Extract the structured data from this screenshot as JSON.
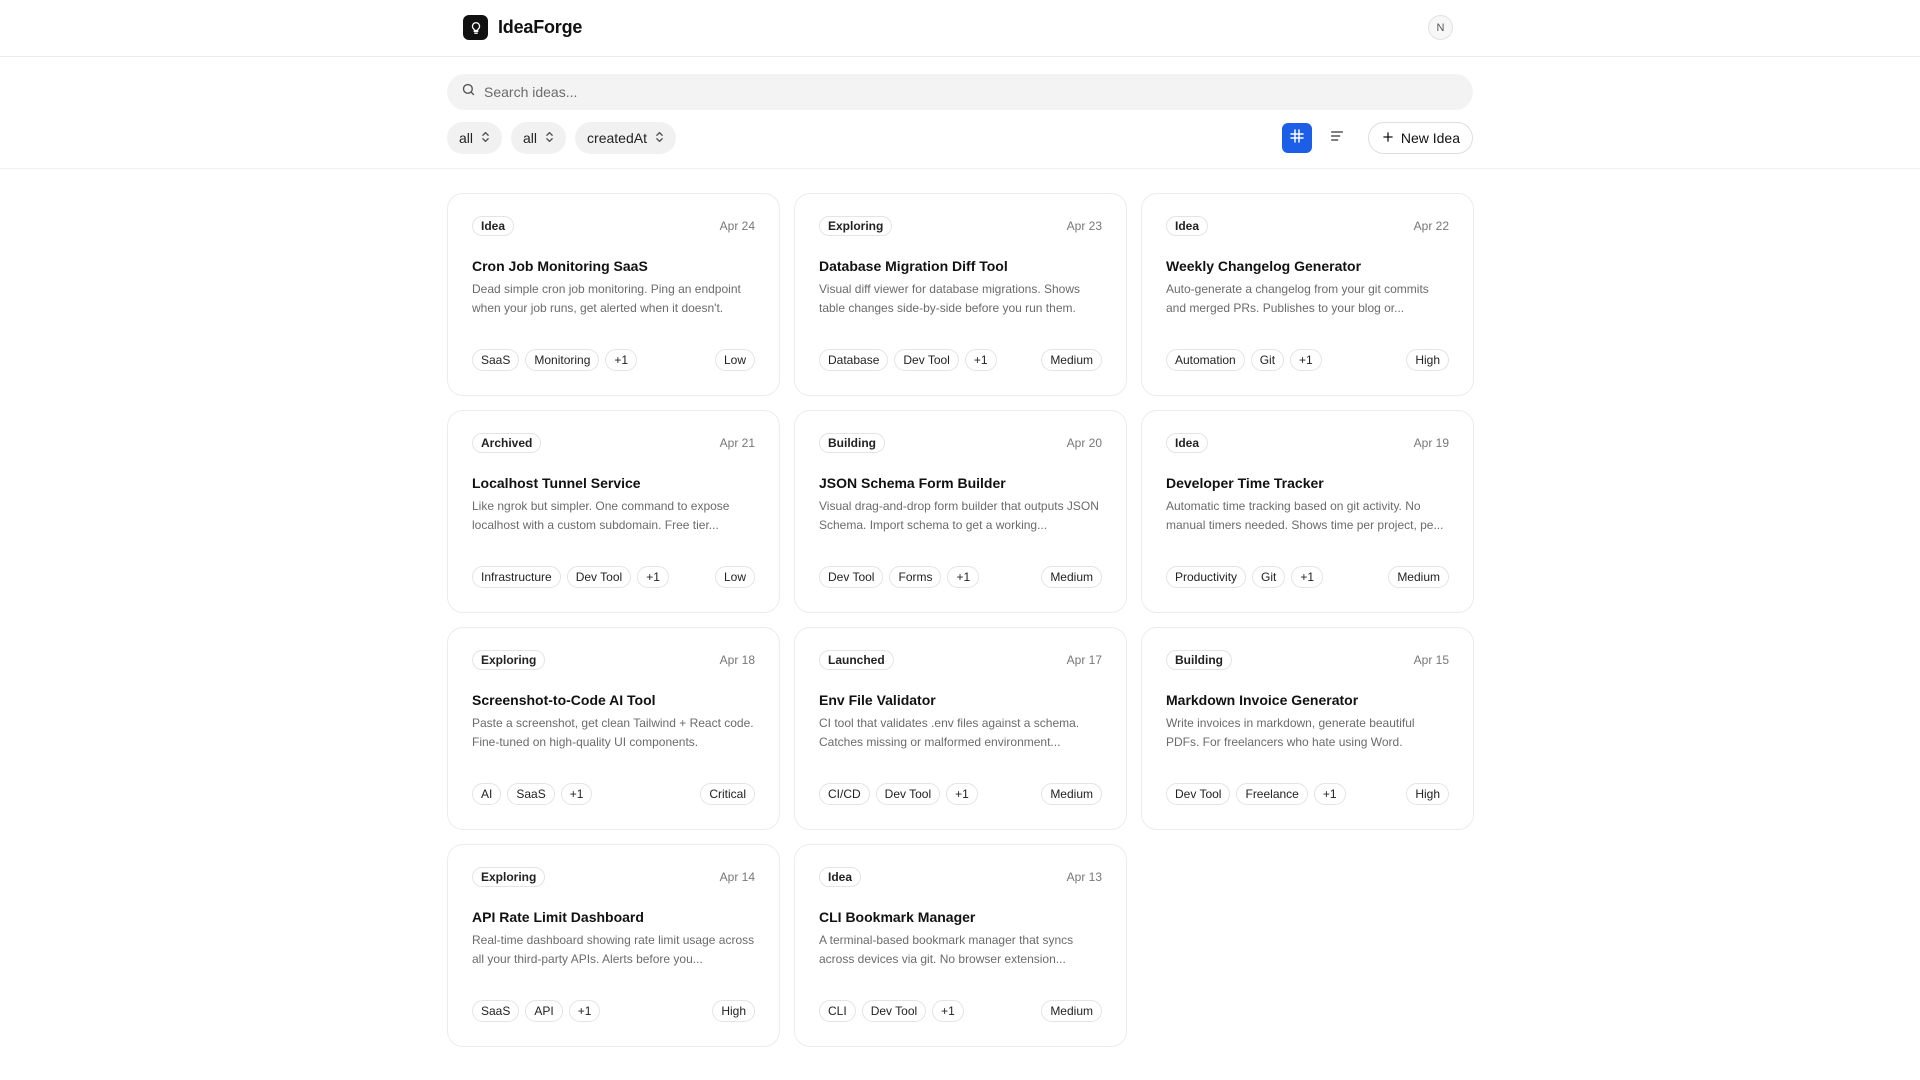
{
  "app": {
    "name": "IdeaForge",
    "avatar_initial": "N"
  },
  "search": {
    "placeholder": "Search ideas..."
  },
  "filters": [
    {
      "label": "all"
    },
    {
      "label": "all"
    },
    {
      "label": "createdAt"
    }
  ],
  "toolbar": {
    "new_label": "New Idea"
  },
  "colors": {
    "accent": "#1d5ee8"
  },
  "icons": {
    "logo": "lightbulb-icon",
    "search": "search-icon",
    "sort": "chevron-up-down-icon",
    "grid_view": "hash-icon",
    "list_view": "list-lines-icon",
    "add": "plus-icon"
  },
  "cards": [
    {
      "status": "Idea",
      "date": "Apr 24",
      "title": "Cron Job Monitoring SaaS",
      "desc": "Dead simple cron job monitoring. Ping an endpoint when your job runs, get alerted when it doesn't.",
      "tags": [
        "SaaS",
        "Monitoring",
        "+1"
      ],
      "priority": "Low"
    },
    {
      "status": "Exploring",
      "date": "Apr 23",
      "title": "Database Migration Diff Tool",
      "desc": "Visual diff viewer for database migrations. Shows table changes side-by-side before you run them.",
      "tags": [
        "Database",
        "Dev Tool",
        "+1"
      ],
      "priority": "Medium"
    },
    {
      "status": "Idea",
      "date": "Apr 22",
      "title": "Weekly Changelog Generator",
      "desc": "Auto-generate a changelog from your git commits and merged PRs. Publishes to your blog or...",
      "tags": [
        "Automation",
        "Git",
        "+1"
      ],
      "priority": "High"
    },
    {
      "status": "Archived",
      "date": "Apr 21",
      "title": "Localhost Tunnel Service",
      "desc": "Like ngrok but simpler. One command to expose localhost with a custom subdomain. Free tier...",
      "tags": [
        "Infrastructure",
        "Dev Tool",
        "+1"
      ],
      "priority": "Low"
    },
    {
      "status": "Building",
      "date": "Apr 20",
      "title": "JSON Schema Form Builder",
      "desc": "Visual drag-and-drop form builder that outputs JSON Schema. Import schema to get a working...",
      "tags": [
        "Dev Tool",
        "Forms",
        "+1"
      ],
      "priority": "Medium"
    },
    {
      "status": "Idea",
      "date": "Apr 19",
      "title": "Developer Time Tracker",
      "desc": "Automatic time tracking based on git activity. No manual timers needed. Shows time per project, pe...",
      "tags": [
        "Productivity",
        "Git",
        "+1"
      ],
      "priority": "Medium"
    },
    {
      "status": "Exploring",
      "date": "Apr 18",
      "title": "Screenshot-to-Code AI Tool",
      "desc": "Paste a screenshot, get clean Tailwind + React code. Fine-tuned on high-quality UI components.",
      "tags": [
        "AI",
        "SaaS",
        "+1"
      ],
      "priority": "Critical"
    },
    {
      "status": "Launched",
      "date": "Apr 17",
      "title": "Env File Validator",
      "desc": "CI tool that validates .env files against a schema. Catches missing or malformed environment...",
      "tags": [
        "CI/CD",
        "Dev Tool",
        "+1"
      ],
      "priority": "Medium"
    },
    {
      "status": "Building",
      "date": "Apr 15",
      "title": "Markdown Invoice Generator",
      "desc": "Write invoices in markdown, generate beautiful PDFs. For freelancers who hate using Word.",
      "tags": [
        "Dev Tool",
        "Freelance",
        "+1"
      ],
      "priority": "High"
    },
    {
      "status": "Exploring",
      "date": "Apr 14",
      "title": "API Rate Limit Dashboard",
      "desc": "Real-time dashboard showing rate limit usage across all your third-party APIs. Alerts before you...",
      "tags": [
        "SaaS",
        "API",
        "+1"
      ],
      "priority": "High"
    },
    {
      "status": "Idea",
      "date": "Apr 13",
      "title": "CLI Bookmark Manager",
      "desc": "A terminal-based bookmark manager that syncs across devices via git. No browser extension...",
      "tags": [
        "CLI",
        "Dev Tool",
        "+1"
      ],
      "priority": "Medium"
    }
  ]
}
